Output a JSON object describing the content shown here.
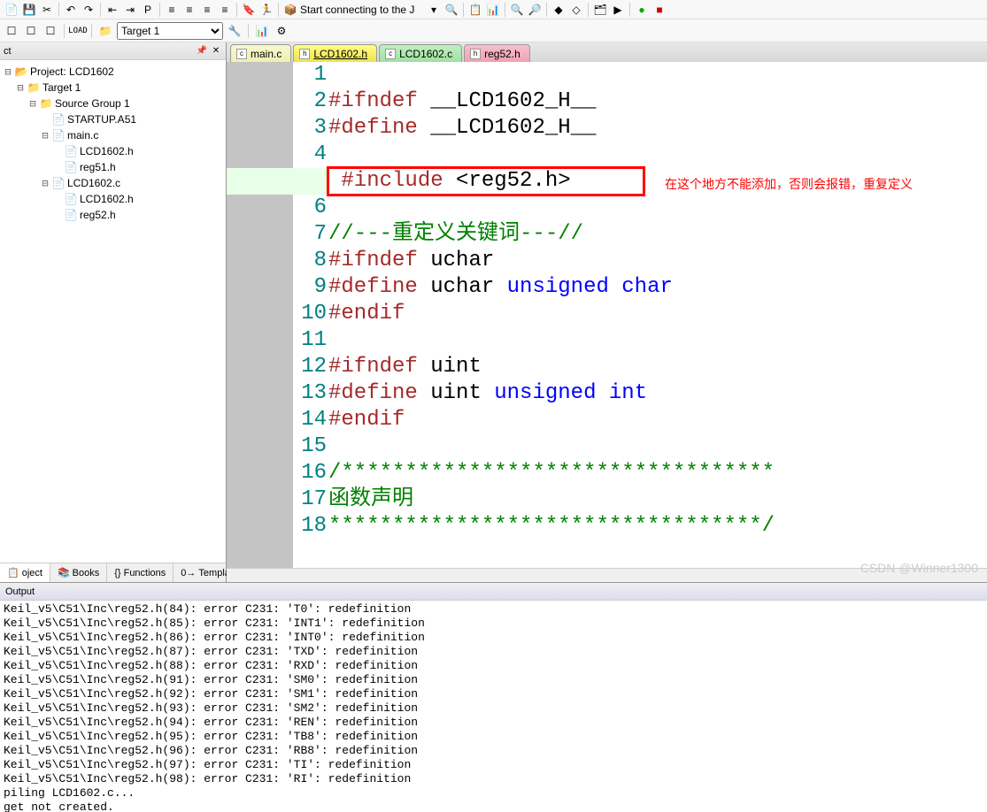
{
  "toolbar": {
    "target_label": "Target 1",
    "connecting_text": "Start connecting to the J"
  },
  "project_panel": {
    "title": "ct",
    "root": "Project: LCD1602",
    "target": "Target 1",
    "group": "Source Group 1",
    "files": {
      "startup": "STARTUP.A51",
      "mainc": "main.c",
      "lcd_h1": "LCD1602.h",
      "reg51": "reg51.h",
      "lcdc": "LCD1602.c",
      "lcd_h2": "LCD1602.h",
      "reg52": "reg52.h"
    },
    "tabs": {
      "project": "oject",
      "books": "Books",
      "functions": "Functions",
      "templates": "Templates"
    }
  },
  "editor": {
    "tabs": {
      "main": "main.c",
      "lcd_h": "LCD1602.h",
      "lcd_c": "LCD1602.c",
      "reg52": "reg52.h"
    },
    "lines": [
      "",
      "#ifndef __LCD1602_H__",
      "#define __LCD1602_H__",
      "",
      " #include <reg52.h>",
      "",
      "//---重定义关键词---//",
      "#ifndef uchar",
      "#define uchar unsigned char",
      "#endif",
      "",
      "#ifndef uint",
      "#define uint unsigned int",
      "#endif",
      "",
      "/**********************************",
      "函数声明",
      "**********************************/"
    ],
    "annotation": "在这个地方不能添加，否则会报错，重复定义"
  },
  "output": {
    "title": "Output",
    "lines": [
      "Keil_v5\\C51\\Inc\\reg52.h(84): error C231: 'T0': redefinition",
      "Keil_v5\\C51\\Inc\\reg52.h(85): error C231: 'INT1': redefinition",
      "Keil_v5\\C51\\Inc\\reg52.h(86): error C231: 'INT0': redefinition",
      "Keil_v5\\C51\\Inc\\reg52.h(87): error C231: 'TXD': redefinition",
      "Keil_v5\\C51\\Inc\\reg52.h(88): error C231: 'RXD': redefinition",
      "Keil_v5\\C51\\Inc\\reg52.h(91): error C231: 'SM0': redefinition",
      "Keil_v5\\C51\\Inc\\reg52.h(92): error C231: 'SM1': redefinition",
      "Keil_v5\\C51\\Inc\\reg52.h(93): error C231: 'SM2': redefinition",
      "Keil_v5\\C51\\Inc\\reg52.h(94): error C231: 'REN': redefinition",
      "Keil_v5\\C51\\Inc\\reg52.h(95): error C231: 'TB8': redefinition",
      "Keil_v5\\C51\\Inc\\reg52.h(96): error C231: 'RB8': redefinition",
      "Keil_v5\\C51\\Inc\\reg52.h(97): error C231: 'TI': redefinition",
      "Keil_v5\\C51\\Inc\\reg52.h(98): error C231: 'RI': redefinition",
      "piling LCD1602.c...",
      "get not created."
    ]
  },
  "watermark": "CSDN @Winner1300"
}
